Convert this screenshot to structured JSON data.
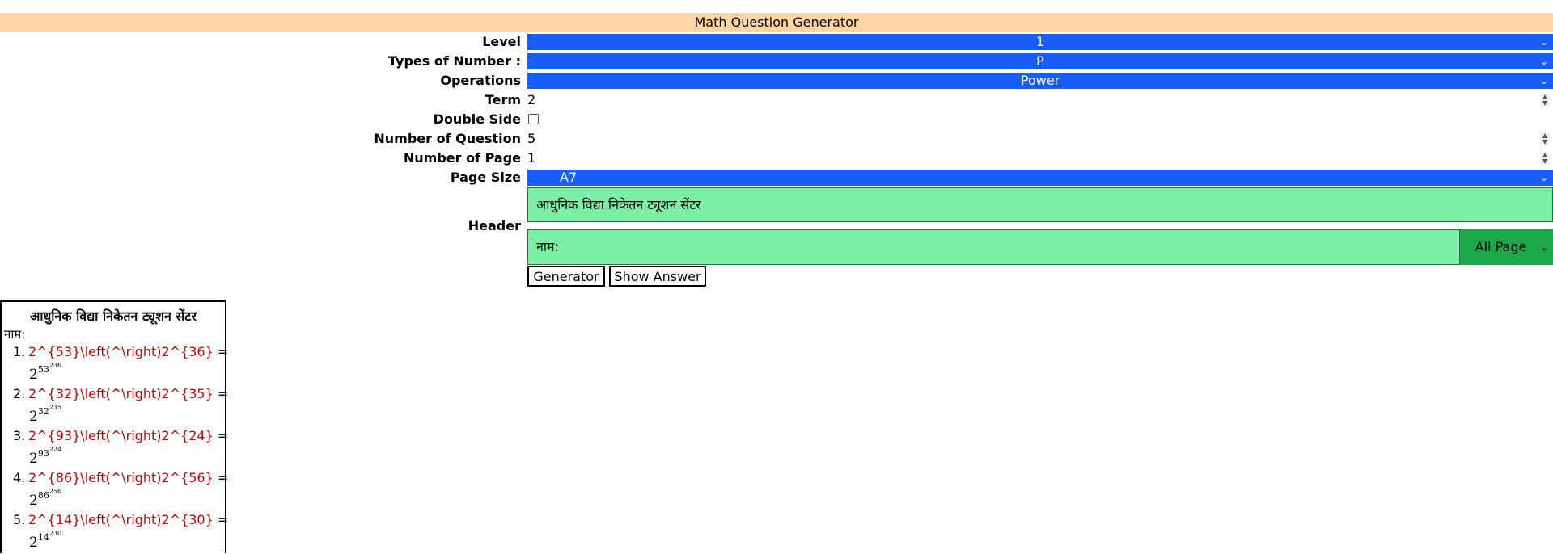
{
  "title": "Math Question Generator",
  "form": {
    "level": {
      "label": "Level",
      "value": "1"
    },
    "types": {
      "label": "Types of Number :",
      "value": "P"
    },
    "operations": {
      "label": "Operations",
      "value": "Power"
    },
    "term": {
      "label": "Term",
      "value": "2"
    },
    "double_side": {
      "label": "Double Side",
      "checked": false
    },
    "num_questions": {
      "label": "Number of Question",
      "value": "5"
    },
    "num_pages": {
      "label": "Number of Page",
      "value": "1"
    },
    "page_size": {
      "label": "Page Size",
      "value": "A7"
    },
    "header": {
      "label": "Header",
      "line1": "आधुनिक विद्या निकेतन ट्यूशन सेंटर",
      "line2": "नाम:",
      "page_option": "All Page"
    }
  },
  "buttons": {
    "generator": "Generator",
    "show_answer": "Show Answer"
  },
  "sheet": {
    "title": "आधुनिक विद्या निकेतन ट्यूशन सेंटर",
    "name_label": "नाम:",
    "questions": [
      {
        "num": "1.",
        "text": "2^{53}\\left(^\\right)2^{36}",
        "eq": " =",
        "base": "2",
        "e1": "53",
        "e2": "36"
      },
      {
        "num": "2.",
        "text": "2^{32}\\left(^\\right)2^{35}",
        "eq": " =",
        "base": "2",
        "e1": "32",
        "e2": "35"
      },
      {
        "num": "3.",
        "text": "2^{93}\\left(^\\right)2^{24}",
        "eq": " =",
        "base": "2",
        "e1": "93",
        "e2": "24"
      },
      {
        "num": "4.",
        "text": "2^{86}\\left(^\\right)2^{56}",
        "eq": " =",
        "base": "2",
        "e1": "86",
        "e2": "56"
      },
      {
        "num": "5.",
        "text": "2^{14}\\left(^\\right)2^{30}",
        "eq": " =",
        "base": "2",
        "e1": "14",
        "e2": "30"
      }
    ]
  },
  "colors": {
    "select_bg": "#1a5cf8",
    "title_bg": "#ffd5a3",
    "header_input_bg": "#7bf0a4",
    "page_select_bg": "#1aa84a",
    "question_text": "#d00000"
  }
}
